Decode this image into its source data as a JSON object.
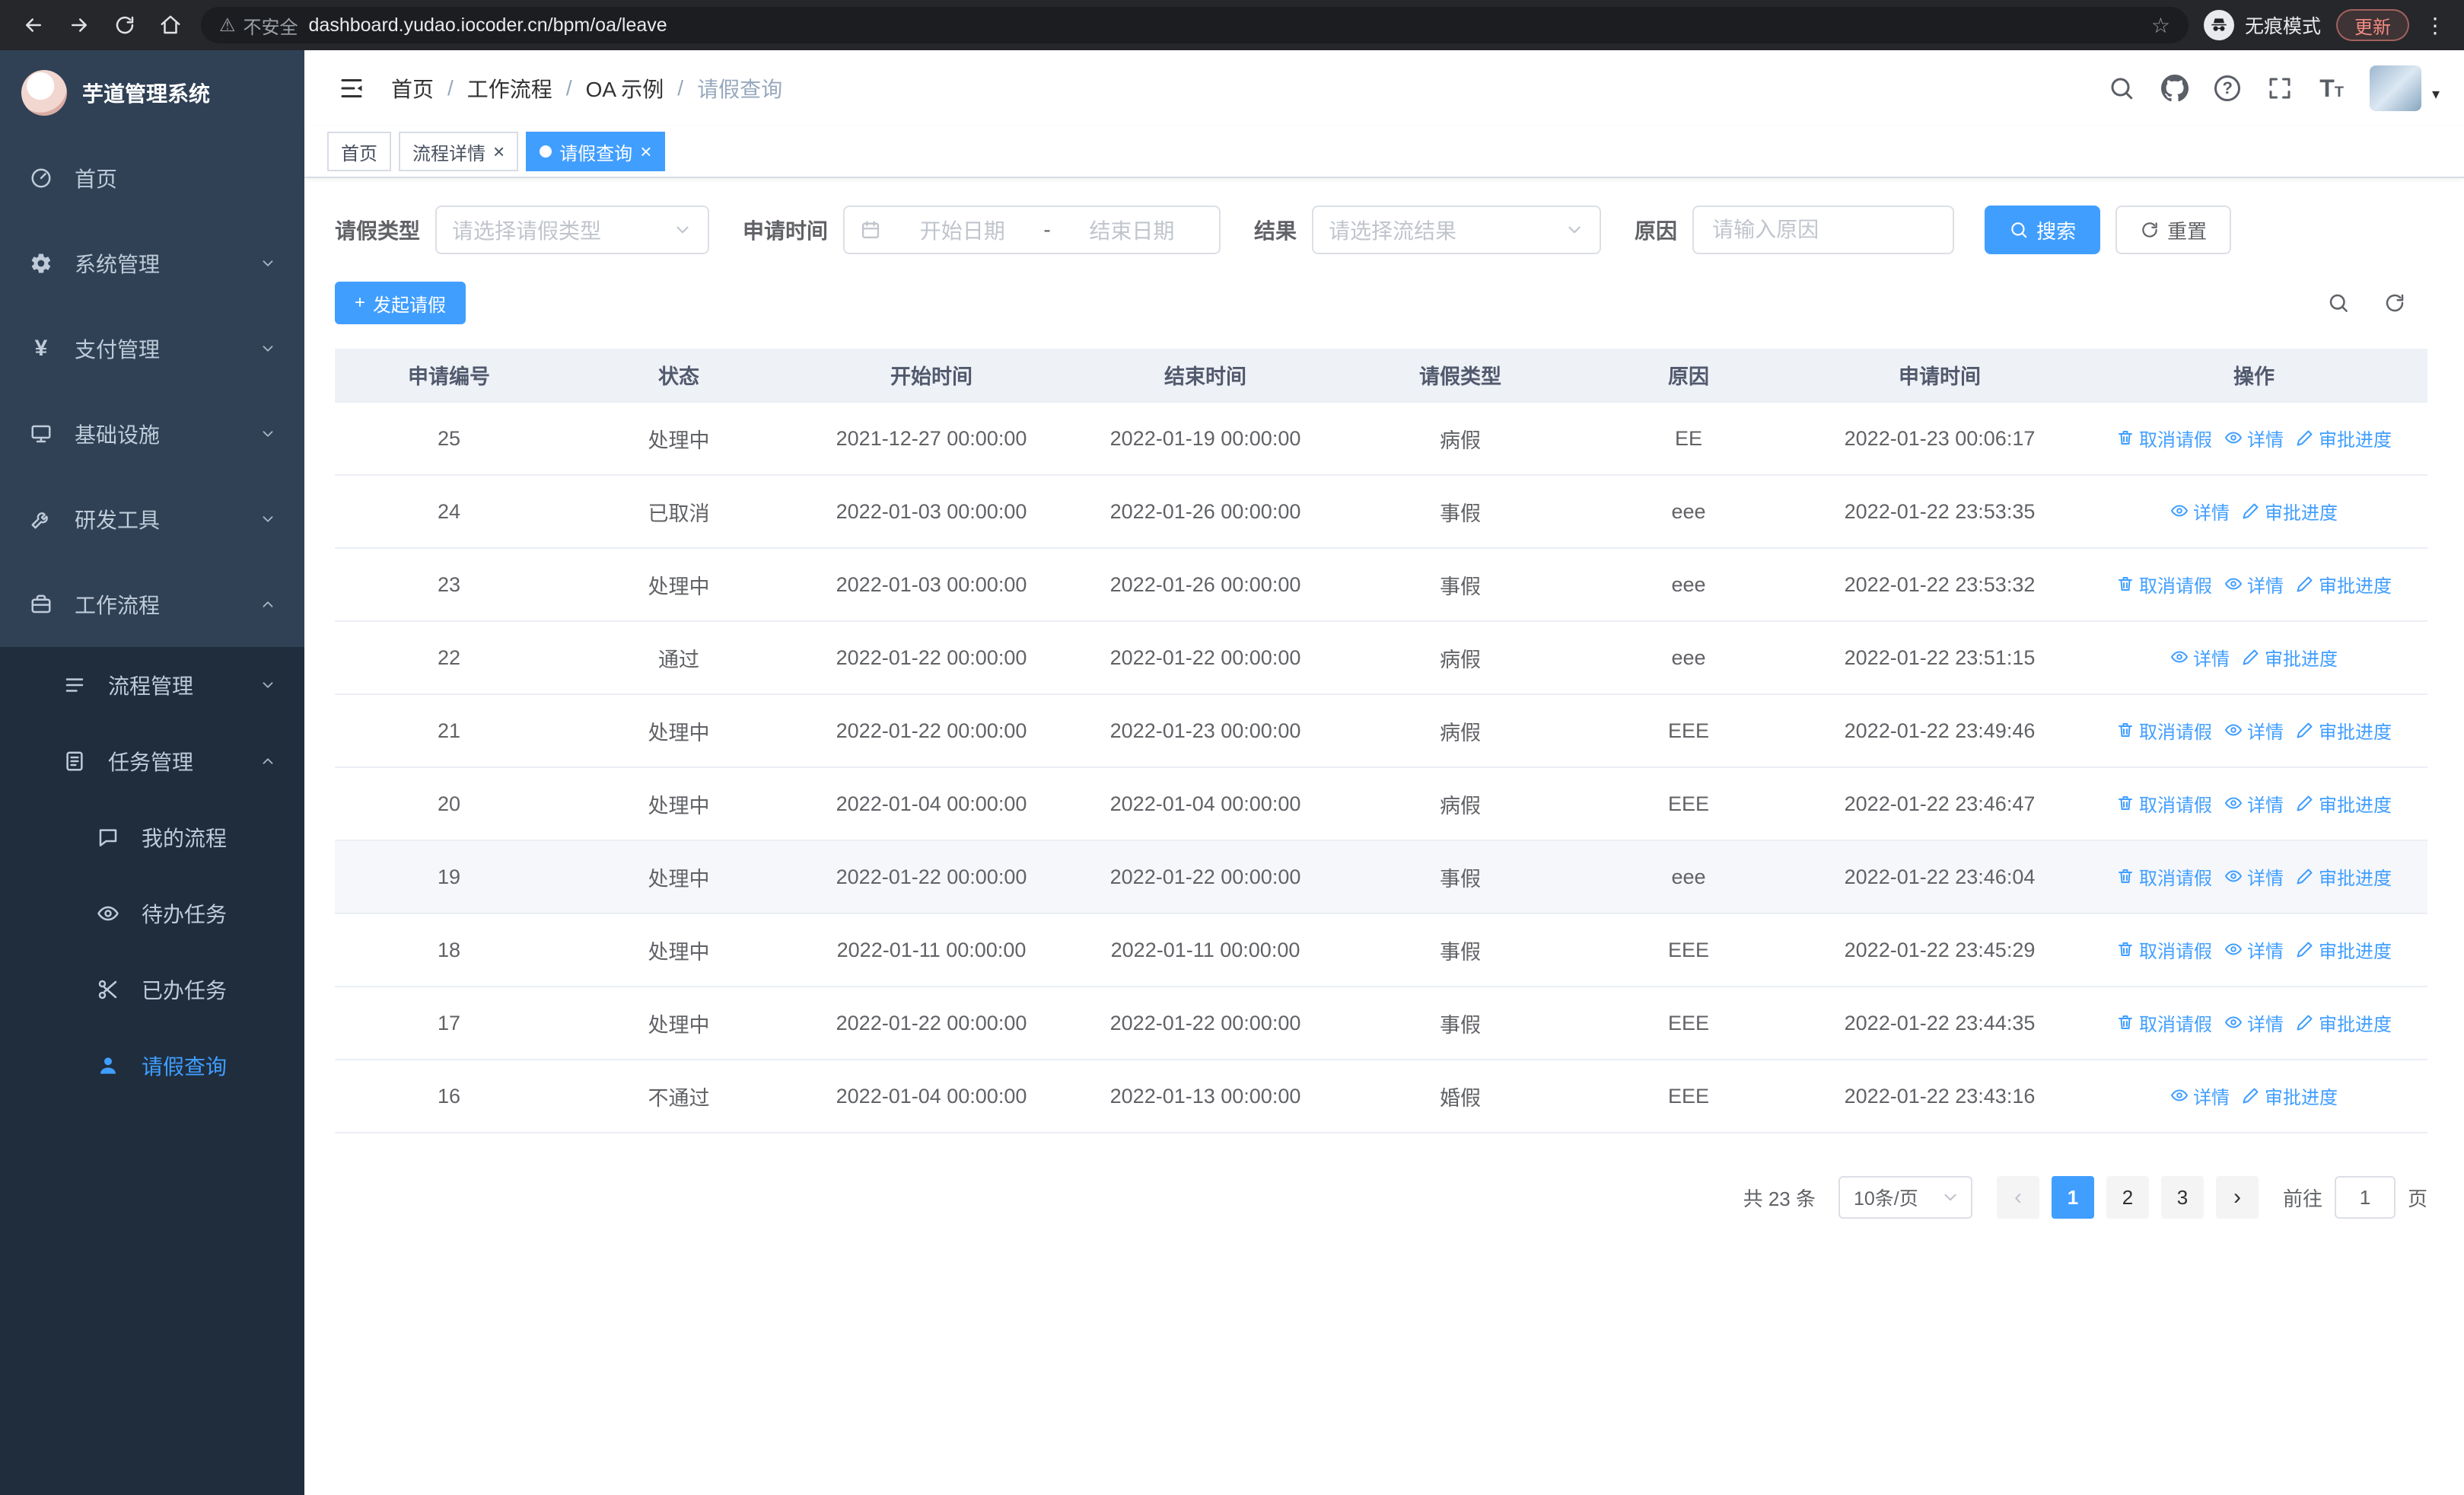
{
  "browser": {
    "security_label": "不安全",
    "url": "dashboard.yudao.iocoder.cn/bpm/oa/leave",
    "incognito_label": "无痕模式",
    "update_label": "更新"
  },
  "app": {
    "logo_title": "芋道管理系统"
  },
  "sidebar": {
    "items": [
      {
        "label": "首页",
        "icon": "dashboard-icon",
        "arrow": ""
      },
      {
        "label": "系统管理",
        "icon": "gear-icon",
        "arrow": "down"
      },
      {
        "label": "支付管理",
        "icon": "payment-icon",
        "arrow": "down"
      },
      {
        "label": "基础设施",
        "icon": "infrastructure-icon",
        "arrow": "down"
      },
      {
        "label": "研发工具",
        "icon": "devtools-icon",
        "arrow": "down"
      },
      {
        "label": "工作流程",
        "icon": "workflow-icon",
        "arrow": "up"
      }
    ],
    "workflow_children": [
      {
        "label": "流程管理",
        "icon": "process-icon",
        "arrow": "down"
      },
      {
        "label": "任务管理",
        "icon": "task-icon",
        "arrow": "up"
      }
    ],
    "task_children": [
      {
        "label": "我的流程",
        "icon": "chat-icon"
      },
      {
        "label": "待办任务",
        "icon": "eye-icon"
      },
      {
        "label": "已办任务",
        "icon": "done-icon"
      },
      {
        "label": "请假查询",
        "icon": "user-icon",
        "active": true
      }
    ]
  },
  "navbar": {
    "breadcrumb": [
      "首页",
      "工作流程",
      "OA 示例",
      "请假查询"
    ]
  },
  "tabs": [
    {
      "label": "首页",
      "active": false,
      "closable": false,
      "dot": false
    },
    {
      "label": "流程详情",
      "active": false,
      "closable": true,
      "dot": false
    },
    {
      "label": "请假查询",
      "active": true,
      "closable": true,
      "dot": true
    }
  ],
  "filters": {
    "leave_type_label": "请假类型",
    "leave_type_placeholder": "请选择请假类型",
    "apply_time_label": "申请时间",
    "start_date_placeholder": "开始日期",
    "range_separator": "-",
    "end_date_placeholder": "结束日期",
    "result_label": "结果",
    "result_placeholder": "请选择流结果",
    "reason_label": "原因",
    "reason_placeholder": "请输入原因",
    "search_label": "搜索",
    "reset_label": "重置"
  },
  "toolbar": {
    "create_label": "发起请假"
  },
  "table": {
    "columns": [
      "申请编号",
      "状态",
      "开始时间",
      "结束时间",
      "请假类型",
      "原因",
      "申请时间",
      "操作"
    ],
    "actions": {
      "cancel": {
        "label": "取消请假",
        "icon": "trash-icon"
      },
      "detail": {
        "label": "详情",
        "icon": "eye-icon"
      },
      "progress": {
        "label": "审批进度",
        "icon": "edit-icon"
      }
    },
    "rows": [
      {
        "id": "25",
        "status": "处理中",
        "start": "2021-12-27 00:00:00",
        "end": "2022-01-19 00:00:00",
        "type": "病假",
        "reason": "EE",
        "applied": "2022-01-23 00:06:17",
        "actions": [
          "cancel",
          "detail",
          "progress"
        ]
      },
      {
        "id": "24",
        "status": "已取消",
        "start": "2022-01-03 00:00:00",
        "end": "2022-01-26 00:00:00",
        "type": "事假",
        "reason": "eee",
        "applied": "2022-01-22 23:53:35",
        "actions": [
          "detail",
          "progress"
        ]
      },
      {
        "id": "23",
        "status": "处理中",
        "start": "2022-01-03 00:00:00",
        "end": "2022-01-26 00:00:00",
        "type": "事假",
        "reason": "eee",
        "applied": "2022-01-22 23:53:32",
        "actions": [
          "cancel",
          "detail",
          "progress"
        ]
      },
      {
        "id": "22",
        "status": "通过",
        "start": "2022-01-22 00:00:00",
        "end": "2022-01-22 00:00:00",
        "type": "病假",
        "reason": "eee",
        "applied": "2022-01-22 23:51:15",
        "actions": [
          "detail",
          "progress"
        ]
      },
      {
        "id": "21",
        "status": "处理中",
        "start": "2022-01-22 00:00:00",
        "end": "2022-01-23 00:00:00",
        "type": "病假",
        "reason": "EEE",
        "applied": "2022-01-22 23:49:46",
        "actions": [
          "cancel",
          "detail",
          "progress"
        ]
      },
      {
        "id": "20",
        "status": "处理中",
        "start": "2022-01-04 00:00:00",
        "end": "2022-01-04 00:00:00",
        "type": "病假",
        "reason": "EEE",
        "applied": "2022-01-22 23:46:47",
        "actions": [
          "cancel",
          "detail",
          "progress"
        ]
      },
      {
        "id": "19",
        "status": "处理中",
        "start": "2022-01-22 00:00:00",
        "end": "2022-01-22 00:00:00",
        "type": "事假",
        "reason": "eee",
        "applied": "2022-01-22 23:46:04",
        "actions": [
          "cancel",
          "detail",
          "progress"
        ],
        "hover": true
      },
      {
        "id": "18",
        "status": "处理中",
        "start": "2022-01-11 00:00:00",
        "end": "2022-01-11 00:00:00",
        "type": "事假",
        "reason": "EEE",
        "applied": "2022-01-22 23:45:29",
        "actions": [
          "cancel",
          "detail",
          "progress"
        ]
      },
      {
        "id": "17",
        "status": "处理中",
        "start": "2022-01-22 00:00:00",
        "end": "2022-01-22 00:00:00",
        "type": "事假",
        "reason": "EEE",
        "applied": "2022-01-22 23:44:35",
        "actions": [
          "cancel",
          "detail",
          "progress"
        ]
      },
      {
        "id": "16",
        "status": "不通过",
        "start": "2022-01-04 00:00:00",
        "end": "2022-01-13 00:00:00",
        "type": "婚假",
        "reason": "EEE",
        "applied": "2022-01-22 23:43:16",
        "actions": [
          "detail",
          "progress"
        ]
      }
    ]
  },
  "pagination": {
    "total": "共 23 条",
    "page_size": "10条/页",
    "pages": [
      "1",
      "2",
      "3"
    ],
    "active_page": "1",
    "goto_label": "前往",
    "goto_value": "1",
    "goto_unit": "页"
  }
}
